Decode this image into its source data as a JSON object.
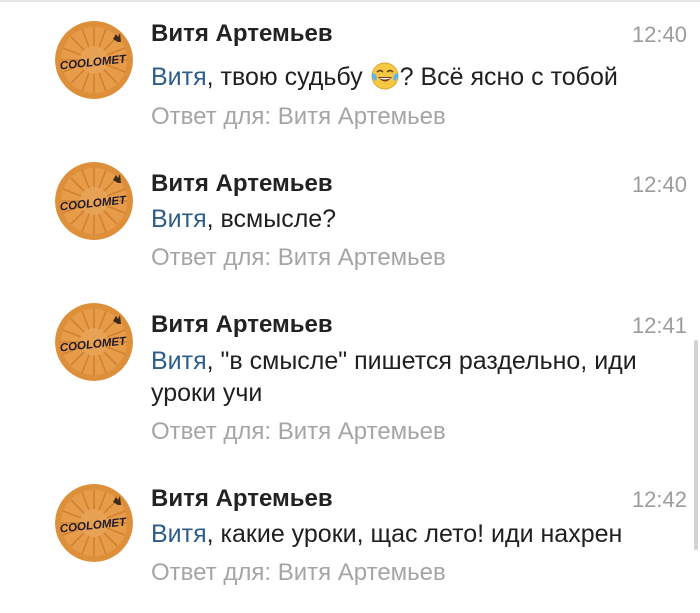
{
  "messages": [
    {
      "avatar_text": "COOLOMET",
      "sender": "Витя Артемьев",
      "time": "12:40",
      "mention": "Витя",
      "text_before_emoji": ", твою судьбу ",
      "emoji": "face-with-tears-of-joy",
      "text_after_emoji": "? Всё ясно с тобой",
      "reply": "Ответ для: Витя Артемьев"
    },
    {
      "avatar_text": "COOLOMET",
      "sender": "Витя Артемьев",
      "time": "12:40",
      "mention": "Витя",
      "text": ", всмысле?",
      "reply": "Ответ для: Витя Артемьев"
    },
    {
      "avatar_text": "COOLOMET",
      "sender": "Витя Артемьев",
      "time": "12:41",
      "mention": "Витя",
      "text": ", \"в смысле\" пишется раздельно, иди уроки учи",
      "reply": "Ответ для: Витя Артемьев"
    },
    {
      "avatar_text": "COOLOMET",
      "sender": "Витя Артемьев",
      "time": "12:42",
      "mention": "Витя",
      "text": ", какие уроки, щас лето! иди нахрен",
      "reply": "Ответ для: Витя Артемьев"
    }
  ],
  "colors": {
    "mention": "#2d5d8b",
    "time": "#9c9c9c",
    "reply": "#a5a5a5",
    "sender": "#222222",
    "avatar_bg": "#e0913a"
  }
}
